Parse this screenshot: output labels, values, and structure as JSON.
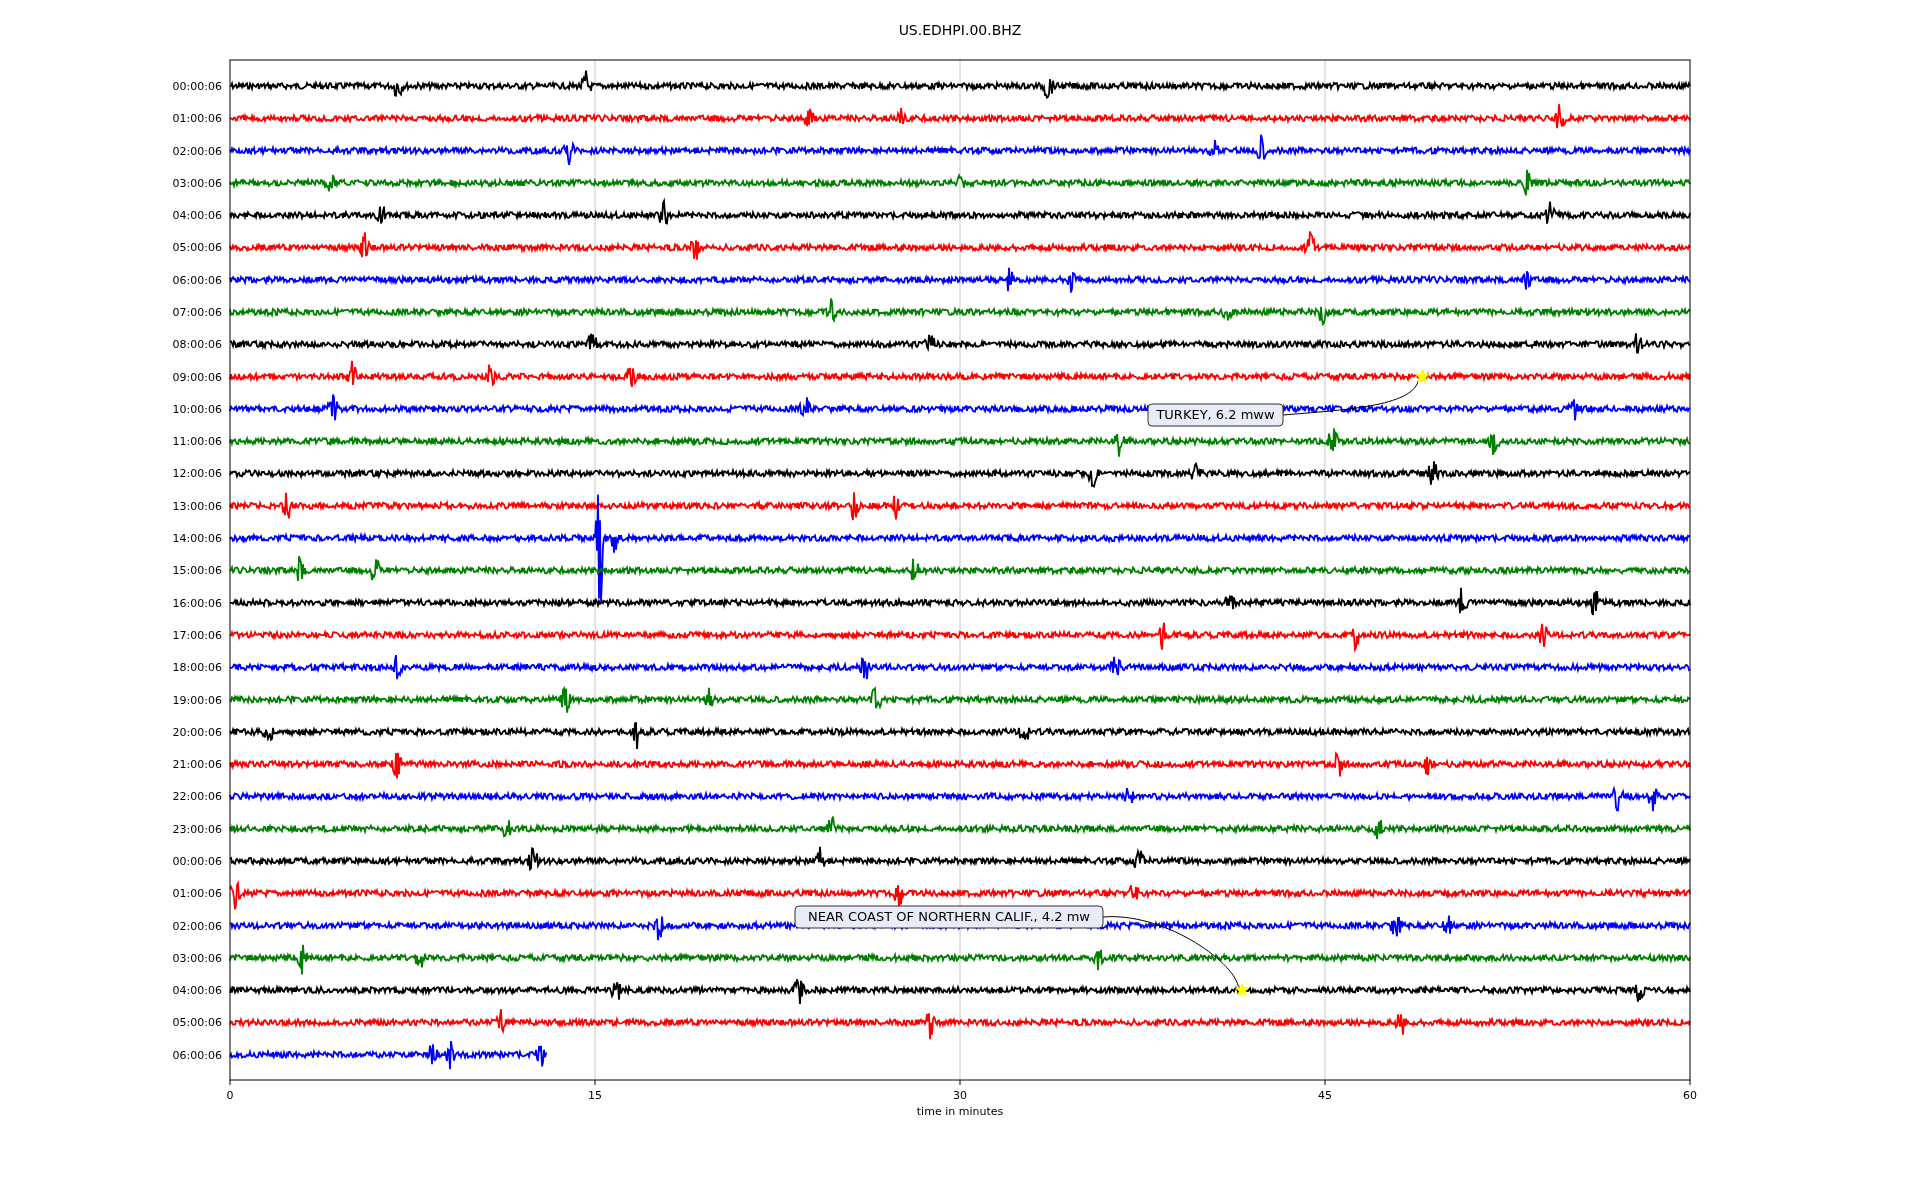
{
  "title": "US.EDHPI.00.BHZ",
  "xlabel": "time in minutes",
  "xticks": [
    "0",
    "15",
    "30",
    "45",
    "60"
  ],
  "rows": [
    {
      "label": "00:00:06",
      "color": "#000000",
      "level": 1
    },
    {
      "label": "01:00:06",
      "color": "#ff0000",
      "level": 1
    },
    {
      "label": "02:00:06",
      "color": "#0000ff",
      "level": 1
    },
    {
      "label": "03:00:06",
      "color": "#008000",
      "level": 1
    },
    {
      "label": "04:00:06",
      "color": "#000000",
      "level": 1
    },
    {
      "label": "05:00:06",
      "color": "#ff0000",
      "level": 1
    },
    {
      "label": "06:00:06",
      "color": "#0000ff",
      "level": 1
    },
    {
      "label": "07:00:06",
      "color": "#008000",
      "level": 1
    },
    {
      "label": "08:00:06",
      "color": "#000000",
      "level": 1
    },
    {
      "label": "09:00:06",
      "color": "#ff0000",
      "level": 1
    },
    {
      "label": "10:00:06",
      "color": "#0000ff",
      "level": 1
    },
    {
      "label": "11:00:06",
      "color": "#008000",
      "level": 1
    },
    {
      "label": "12:00:06",
      "color": "#000000",
      "level": 1
    },
    {
      "label": "13:00:06",
      "color": "#ff0000",
      "level": 1
    },
    {
      "label": "14:00:06",
      "color": "#0000ff",
      "level": 1
    },
    {
      "label": "15:00:06",
      "color": "#008000",
      "level": 1
    },
    {
      "label": "16:00:06",
      "color": "#000000",
      "level": 1
    },
    {
      "label": "17:00:06",
      "color": "#ff0000",
      "level": 1
    },
    {
      "label": "18:00:06",
      "color": "#0000ff",
      "level": 1
    },
    {
      "label": "19:00:06",
      "color": "#008000",
      "level": 1
    },
    {
      "label": "20:00:06",
      "color": "#000000",
      "level": 1
    },
    {
      "label": "21:00:06",
      "color": "#ff0000",
      "level": 1
    },
    {
      "label": "22:00:06",
      "color": "#0000ff",
      "level": 1
    },
    {
      "label": "23:00:06",
      "color": "#008000",
      "level": 1
    },
    {
      "label": "00:00:06",
      "color": "#000000",
      "level": 1
    },
    {
      "label": "01:00:06",
      "color": "#ff0000",
      "level": 1
    },
    {
      "label": "02:00:06",
      "color": "#0000ff",
      "level": 1
    },
    {
      "label": "03:00:06",
      "color": "#008000",
      "level": 1
    },
    {
      "label": "04:00:06",
      "color": "#000000",
      "level": 1
    },
    {
      "label": "05:00:06",
      "color": "#ff0000",
      "level": 1
    },
    {
      "label": "06:00:06",
      "color": "#0000ff",
      "level": 0.217
    }
  ],
  "annotations": [
    {
      "text": "TURKEY, 6.2 mww"
    },
    {
      "text": "NEAR COAST OF NORTHERN CALIF., 4.2 mw"
    }
  ]
}
